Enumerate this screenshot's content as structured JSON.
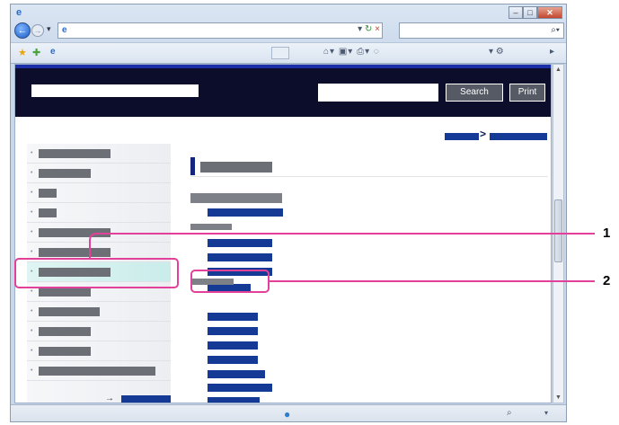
{
  "site": {
    "search_label": "Search",
    "print_label": "Print",
    "breadcrumb_separator": ">"
  },
  "browser": {
    "back_glyph": "←",
    "forward_glyph": "→",
    "address_refresh_glyph": "↻",
    "address_stop_glyph": "×",
    "search_glyph": "⌕"
  },
  "sidebar": {
    "item_count": 12,
    "selected_index": 5
  },
  "callouts": {
    "one": "1",
    "two": "2"
  },
  "colors": {
    "header": "#0b0d2a",
    "link_blue": "#153a96",
    "callout": "#e2409a",
    "selected_item": "#dff5f3"
  },
  "icons": [
    "ie-logo-icon",
    "back-icon",
    "forward-icon",
    "page-icon",
    "refresh-icon",
    "stop-icon",
    "search-icon",
    "favorites-star-icon",
    "add-favorite-icon",
    "home-icon",
    "feeds-icon",
    "print-icon",
    "page-menu-icon",
    "tools-icon",
    "globe-icon",
    "zoom-icon",
    "arrow-right-icon"
  ]
}
